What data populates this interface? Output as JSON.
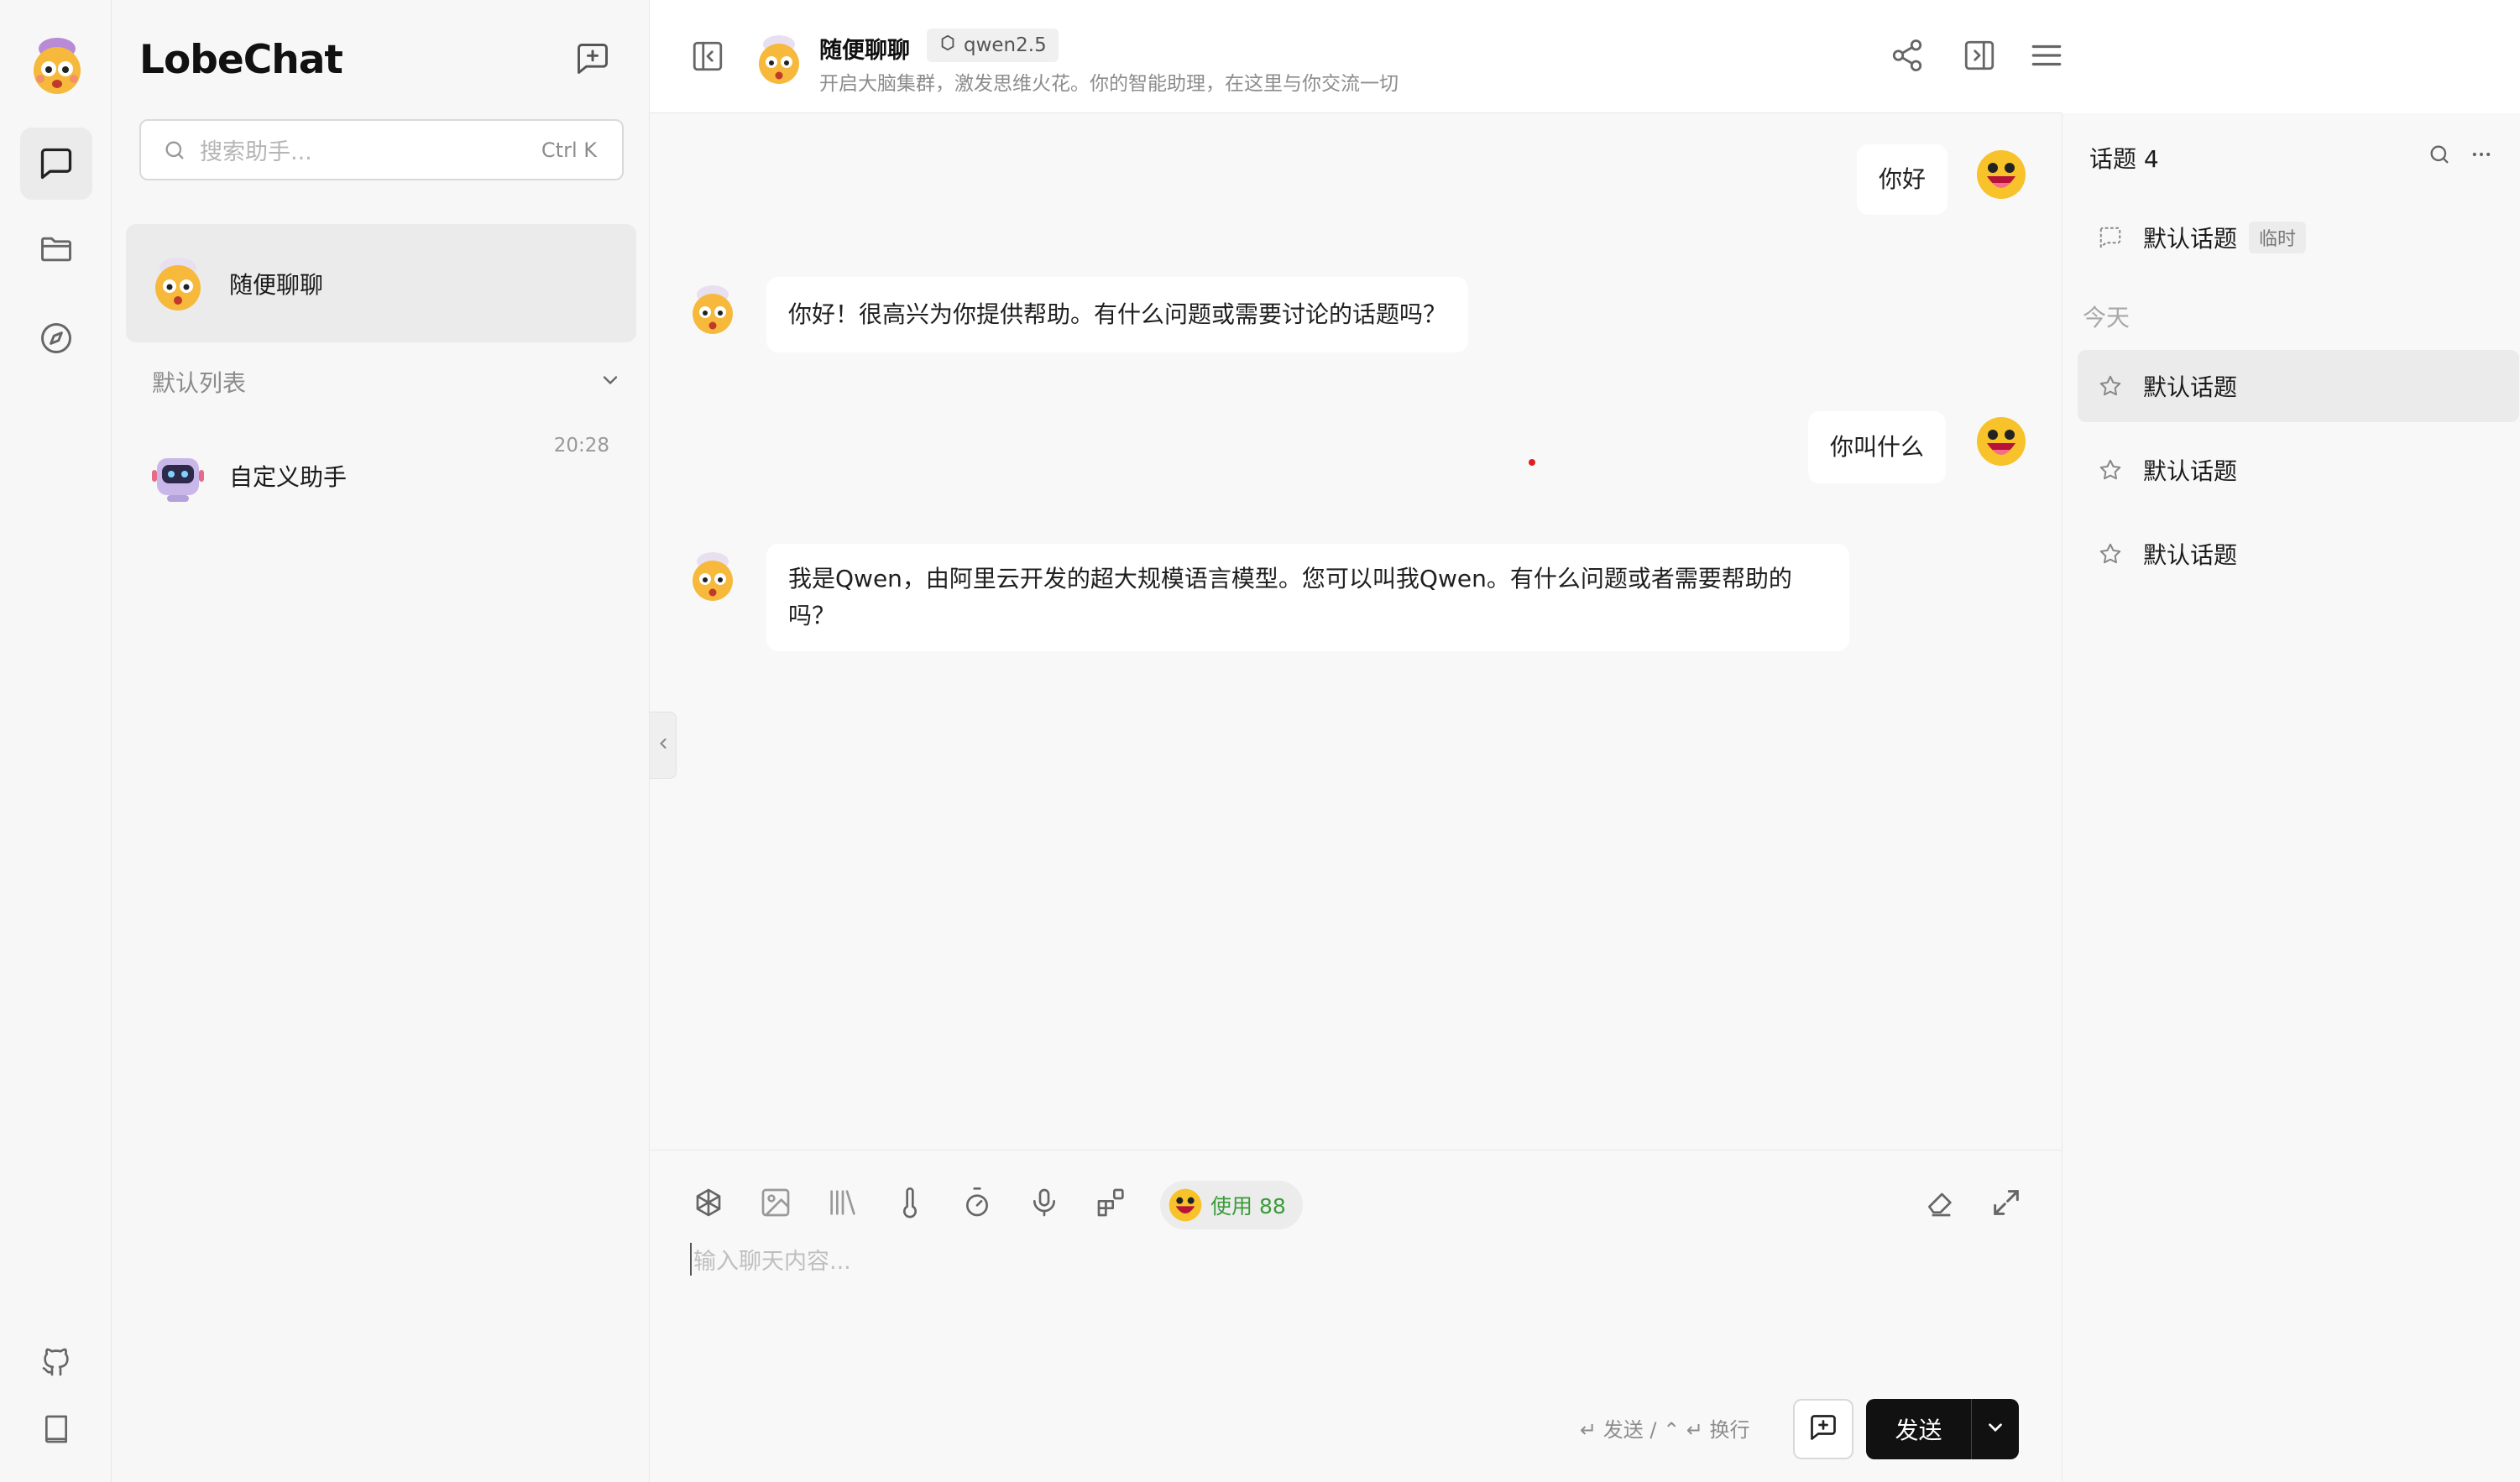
{
  "app": {
    "brand": "LobeChat"
  },
  "search": {
    "placeholder": "搜索助手...",
    "shortcut": "Ctrl K"
  },
  "sessions": {
    "pinned": {
      "title": "随便聊聊"
    },
    "group_label": "默认列表",
    "items": [
      {
        "title": "自定义助手",
        "time": "20:28"
      }
    ]
  },
  "header": {
    "title": "随便聊聊",
    "model": "qwen2.5",
    "description": "开启大脑集群，激发思维火花。你的智能助理，在这里与你交流一切"
  },
  "messages": [
    {
      "role": "user",
      "text": "你好"
    },
    {
      "role": "assistant",
      "text": "你好！很高兴为你提供帮助。有什么问题或需要讨论的话题吗？"
    },
    {
      "role": "user",
      "text": "你叫什么"
    },
    {
      "role": "assistant",
      "text": "我是Qwen，由阿里云开发的超大规模语言模型。您可以叫我Qwen。有什么问题或者需要帮助的吗？"
    }
  ],
  "composer": {
    "usage_label": "使用 88",
    "placeholder": "输入聊天内容...",
    "hint": "↵ 发送 / ⌃ ↵ 换行",
    "send_label": "发送"
  },
  "topics": {
    "heading": "话题 4",
    "current": {
      "title": "默认话题",
      "tag": "临时"
    },
    "today_label": "今天",
    "items": [
      {
        "title": "默认话题"
      },
      {
        "title": "默认话题"
      },
      {
        "title": "默认话题"
      }
    ]
  },
  "colors": {
    "accent_dark": "#111111",
    "usage_green": "#3a9b3a",
    "sidebar_bg": "#f7f7f7"
  },
  "icons": [
    "chat-icon",
    "folder-icon",
    "compass-icon",
    "github-icon",
    "book-icon",
    "share-icon",
    "panel-icon",
    "menu-icon"
  ]
}
